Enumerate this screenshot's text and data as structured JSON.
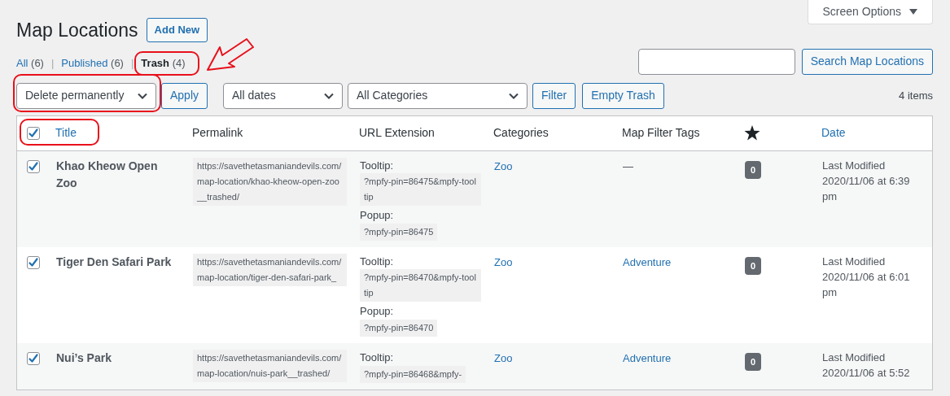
{
  "page_title": "Map Locations",
  "add_new": "Add New",
  "screen_options": "Screen Options",
  "views": [
    {
      "label": "All",
      "count": "(6)",
      "selected": false,
      "separator": "|"
    },
    {
      "label": "Published",
      "count": "(6)",
      "selected": false,
      "separator": "|"
    },
    {
      "label": "Trash",
      "count": "(4)",
      "selected": true
    }
  ],
  "search_button": "Search Map Locations",
  "bulk_action": "Delete permanently",
  "apply": "Apply",
  "date_filter": "All dates",
  "category_filter": "All Categories",
  "filter": "Filter",
  "empty_trash": "Empty Trash",
  "item_count": "4 items",
  "table": {
    "select_all_checked": true,
    "columns": [
      {
        "kind": "text",
        "label": "Title",
        "sortable": true
      },
      {
        "kind": "text",
        "label": "Permalink",
        "sortable": false
      },
      {
        "kind": "text",
        "label": "URL Extension",
        "sortable": false
      },
      {
        "kind": "text",
        "label": "Categories",
        "sortable": false
      },
      {
        "kind": "text",
        "label": "Map Filter Tags",
        "sortable": false
      },
      {
        "kind": "star"
      },
      {
        "kind": "text",
        "label": "Date",
        "sortable": true
      }
    ],
    "rows": [
      {
        "checked": true,
        "title": "Khao Kheow Open Zoo",
        "permalink": "https://savethetasmaniandevils.com/map-location/khao-kheow-open-zoo__trashed/",
        "tooltip_label": "Tooltip:",
        "tooltip_value": "?mpfy-pin=86475&mpfy-tooltip",
        "popup_label": "Popup:",
        "popup_value": "?mpfy-pin=86475",
        "category": "Zoo",
        "tag": {
          "text": "—",
          "link": false
        },
        "rating": "0",
        "date": "Last Modified 2020/11/06 at 6:39 pm"
      },
      {
        "checked": true,
        "title": "Tiger Den Safari Park",
        "permalink": "https://savethetasmaniandevils.com/map-location/tiger-den-safari-park_",
        "tooltip_label": "Tooltip:",
        "tooltip_value": "?mpfy-pin=86470&mpfy-tooltip",
        "popup_label": "Popup:",
        "popup_value": "?mpfy-pin=86470",
        "category": "Zoo",
        "tag": {
          "text": "Adventure",
          "link": true
        },
        "rating": "0",
        "date": "Last Modified 2020/11/06 at 6:01 pm"
      },
      {
        "checked": true,
        "title": "Nui’s Park",
        "permalink": "https://savethetasmaniandevils.com/map-location/nuis-park__trashed/",
        "tooltip_label": "Tooltip:",
        "tooltip_value": "?mpfy-pin=86468&mpfy-",
        "category": "Zoo",
        "tag": {
          "text": "Adventure",
          "link": true
        },
        "rating": "0",
        "date": "Last Modified 2020/11/06 at 5:52"
      }
    ]
  }
}
